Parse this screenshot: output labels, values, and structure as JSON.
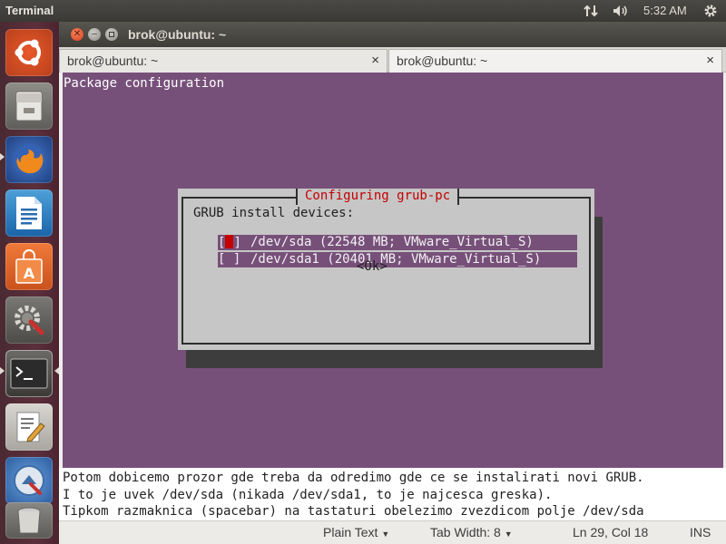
{
  "top_panel": {
    "app_name": "Terminal",
    "clock": "5:32 AM",
    "icons": [
      "network-icon",
      "volume-icon",
      "gear-icon"
    ]
  },
  "launcher": {
    "items": [
      {
        "name": "ubuntu-dash",
        "icon": "ubuntu-logo-icon"
      },
      {
        "name": "files",
        "icon": "file-cabinet-icon"
      },
      {
        "name": "firefox",
        "icon": "firefox-icon"
      },
      {
        "name": "libreoffice-writer",
        "icon": "document-icon"
      },
      {
        "name": "software-center",
        "icon": "shopping-bag-icon"
      },
      {
        "name": "system-settings",
        "icon": "settings-wrench-icon"
      },
      {
        "name": "terminal",
        "icon": "terminal-icon"
      },
      {
        "name": "text-editor",
        "icon": "text-editor-icon"
      },
      {
        "name": "update-manager",
        "icon": "update-icon"
      },
      {
        "name": "trash",
        "icon": "trash-icon"
      }
    ]
  },
  "window": {
    "title": "brok@ubuntu: ~",
    "tabs": [
      {
        "label": "brok@ubuntu: ~",
        "close": "×"
      },
      {
        "label": "brok@ubuntu: ~",
        "close": "×"
      }
    ]
  },
  "terminal": {
    "heading": "Package configuration",
    "dialog": {
      "title": "Configuring grub-pc",
      "prompt": "GRUB install devices:",
      "devices": [
        {
          "check_left": "[",
          "check_right": "]",
          "label": "/dev/sda (22548 MB; VMware_Virtual_S)",
          "selected": true
        },
        {
          "check": "[ ]",
          "label": "/dev/sda1 (20401 MB; VMware_Virtual_S)",
          "selected": false
        }
      ],
      "ok": "<Ok>"
    }
  },
  "description": [
    "Potom dobicemo prozor gde treba da odredimo gde ce se instalirati novi GRUB.",
    "I to je uvek /dev/sda (nikada /dev/sda1, to je najcesca greska).",
    "Tipkom razmaknica (spacebar) na tastaturi obelezimo zvezdicom polje /dev/sda"
  ],
  "statusbar": {
    "mode": "Plain Text",
    "tab_width_label": "Tab Width:",
    "tab_width": "8",
    "position": "Ln 29, Col 18",
    "insert": "INS"
  },
  "colors": {
    "terminal_bg": "#77507a",
    "dialog_bg": "#c6c6c6",
    "dialog_title": "#c40000",
    "launcher_bg": "#5c2f3c"
  }
}
